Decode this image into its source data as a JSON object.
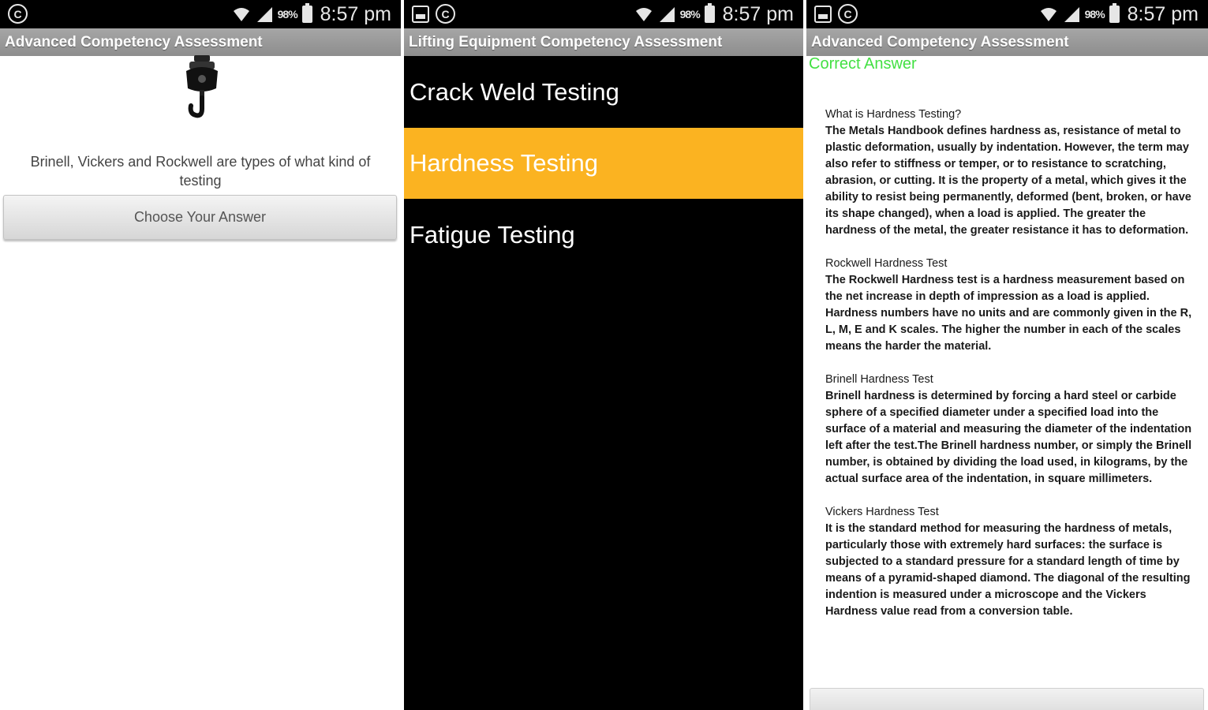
{
  "status_bar": {
    "battery_percent": "98%",
    "time": "8:57 pm",
    "icons": [
      "copyright-icon",
      "gallery-icon",
      "wifi-icon",
      "signal-icon",
      "battery-icon"
    ]
  },
  "screen1": {
    "title": "Advanced Competency Assessment",
    "icon": "crane-hook-icon",
    "question": "Brinell, Vickers and Rockwell are types of what kind of testing",
    "button_label": "Choose Your Answer"
  },
  "screen2": {
    "title": "Lifting Equipment Competency Assessment",
    "options": [
      {
        "label": "Crack Weld Testing",
        "selected": false
      },
      {
        "label": "Hardness Testing",
        "selected": true
      },
      {
        "label": "Fatigue Testing",
        "selected": false
      }
    ],
    "selected_color": "#fbb321"
  },
  "screen3": {
    "title": "Advanced Competency Assessment",
    "result": "Correct Answer",
    "result_color": "#43e043",
    "sections": [
      {
        "heading": "What is Hardness Testing?",
        "body": "The Metals Handbook defines hardness as, resistance of metal to plastic deformation, usually by indentation. However, the term may also refer to stiffness or temper, or to resistance to scratching, abrasion, or cutting. It is the property of a metal, which gives it the ability to resist being permanently, deformed (bent, broken, or have its shape changed), when a load is applied. The greater the hardness of the metal, the greater resistance it has to deformation."
      },
      {
        "heading": "Rockwell Hardness Test",
        "body": "The Rockwell Hardness test is a hardness measurement based on the net increase in depth of impression as a load is applied. Hardness numbers have no units and are commonly given in the R, L, M, E and K scales. The higher the number in each of the scales means the harder the material."
      },
      {
        "heading": "Brinell Hardness Test",
        "body": "Brinell hardness is determined by forcing a hard steel or carbide sphere of a specified diameter under a specified load into the surface of a material and measuring the diameter of the indentation left after the test.The Brinell hardness number, or simply the Brinell number, is obtained by dividing the load used, in kilograms, by the actual surface area of the indentation, in square millimeters."
      },
      {
        "heading": "Vickers Hardness Test",
        "body": "It is the standard method for measuring the hardness of metals, particularly those with extremely hard surfaces: the surface is subjected to a standard pressure for a standard length of time by means of a pyramid-shaped diamond. The diagonal of the resulting indention is measured under a microscope and the Vickers Hardness value read from a conversion table."
      }
    ]
  }
}
